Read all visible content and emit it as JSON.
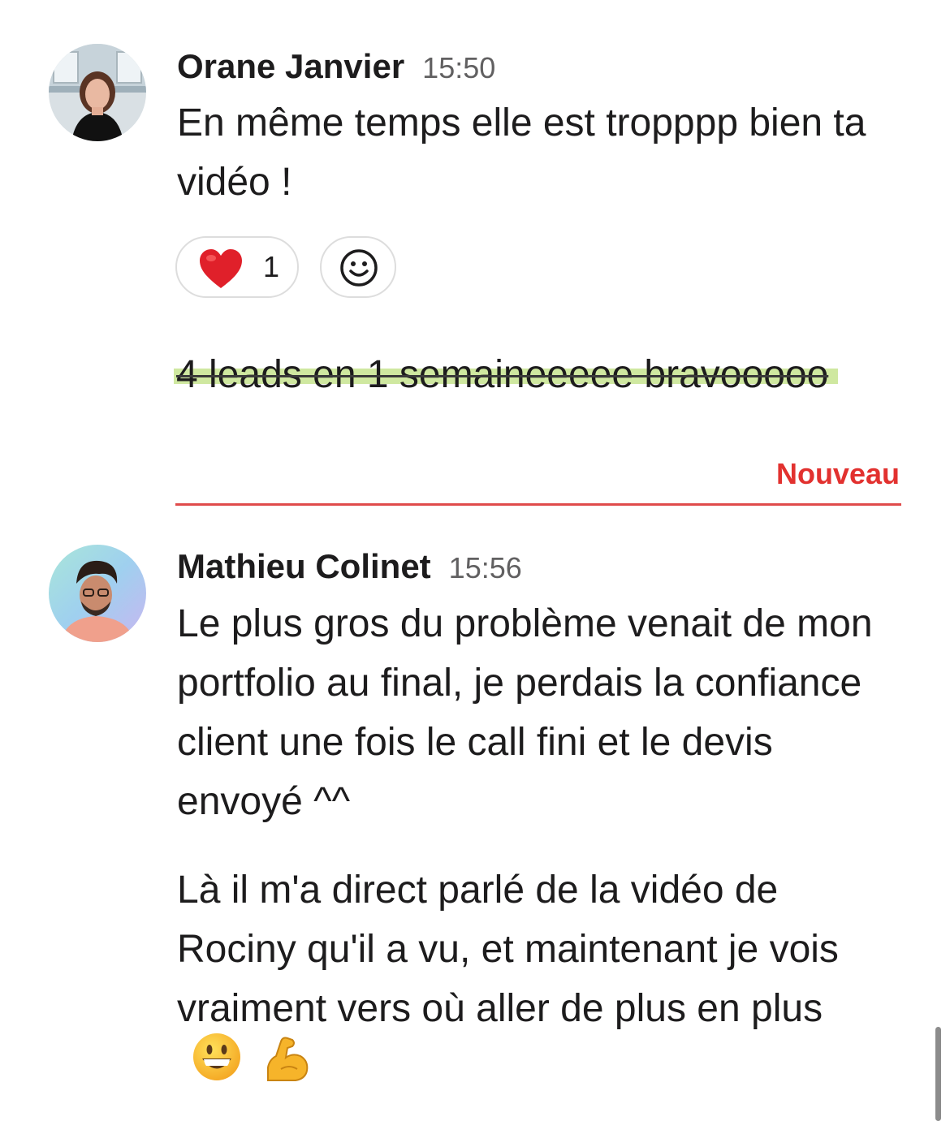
{
  "messages": [
    {
      "author": "Orane Janvier",
      "time": "15:50",
      "text": "En même temps elle est tropppp bien ta vidéo !",
      "reactions": [
        {
          "emoji": "heart-icon",
          "count": "1"
        }
      ],
      "add_reaction_icon": "smiley-icon"
    },
    {
      "text": "4 leads en 1 semaineeeee bravooooo",
      "highlight_color": "#cfe8a0",
      "strikethrough": true
    },
    {
      "author": "Mathieu Colinet",
      "time": "15:56",
      "paragraphs": [
        "Le plus gros du problème venait de mon portfolio au final, je perdais la confiance client une fois le call fini et le devis envoyé ^^",
        "Là il m'a direct parlé de la vidéo de Rociny qu'il a vu, et maintenant je vois vraiment vers où aller de plus en plus"
      ],
      "trailing_emojis": [
        "grinning-face-icon",
        "flexed-biceps-icon"
      ]
    }
  ],
  "divider": {
    "label": "Nouveau",
    "color": "#e04b4b"
  },
  "colors": {
    "text": "#1d1c1d",
    "timestamp": "#616061",
    "new_label": "#e2312f",
    "heart": "#e0202a"
  }
}
